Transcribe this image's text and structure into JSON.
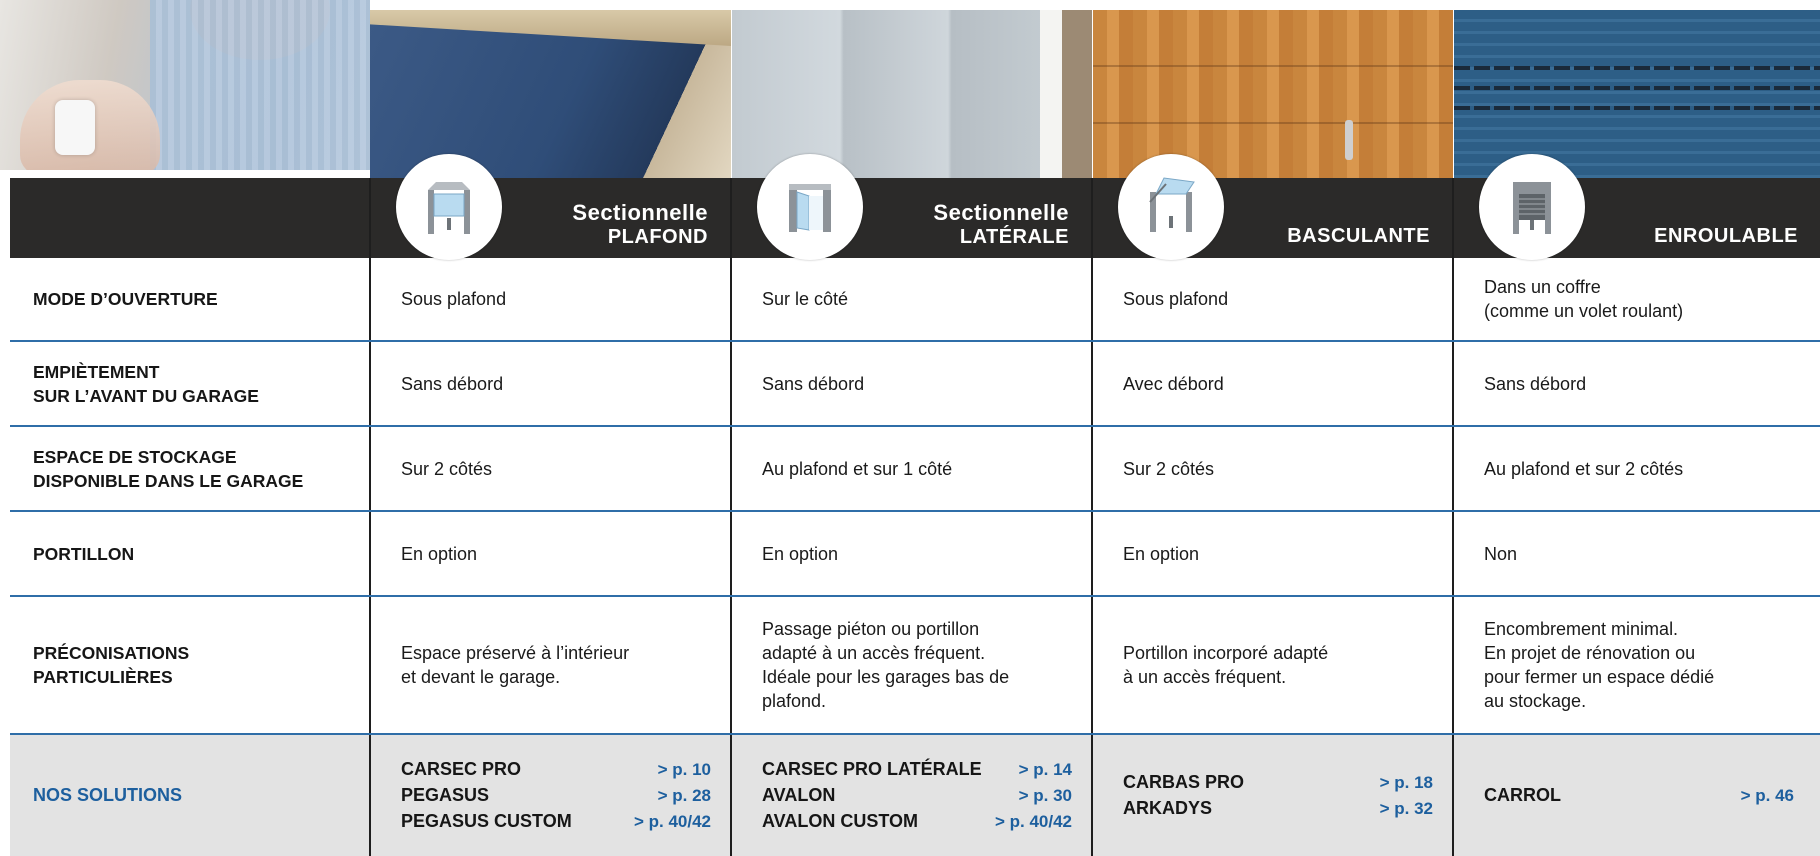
{
  "columns": [
    {
      "title_line1": "Sectionnelle",
      "title_line2": "plafond",
      "icon": "sectional-ceiling-door-icon"
    },
    {
      "title_line1": "Sectionnelle",
      "title_line2": "latérale",
      "icon": "sectional-side-door-icon"
    },
    {
      "title_line1": "",
      "title_line2": "BASCULANTE",
      "icon": "tilting-door-icon"
    },
    {
      "title_line1": "",
      "title_line2": "ENROULABLE",
      "icon": "roller-door-icon"
    }
  ],
  "rows": [
    {
      "label": "MODE D’OUVERTURE",
      "values": [
        "Sous plafond",
        "Sur le côté",
        "Sous plafond",
        "Dans un coffre\n(comme un volet roulant)"
      ]
    },
    {
      "label": "EMPIÈTEMENT\nSUR L’AVANT DU GARAGE",
      "values": [
        "Sans débord",
        "Sans débord",
        "Avec débord",
        "Sans débord"
      ]
    },
    {
      "label": "ESPACE DE STOCKAGE\nDISPONIBLE DANS LE GARAGE",
      "values": [
        "Sur 2 côtés",
        "Au plafond et sur 1 côté",
        "Sur 2 côtés",
        "Au plafond et sur 2 côtés"
      ]
    },
    {
      "label": "PORTILLON",
      "values": [
        "En option",
        "En option",
        "En option",
        "Non"
      ]
    },
    {
      "label": "PRÉCONISATIONS\nPARTICULIÈRES",
      "values": [
        "Espace préservé à l’intérieur\net devant le garage.",
        "Passage piéton ou portillon\nadapté à un accès fréquent.\nIdéale pour les garages bas de\nplafond.",
        "Portillon incorporé adapté\nà un accès fréquent.",
        "Encombrement minimal.\nEn projet de rénovation ou\npour fermer un espace dédié\nau stockage."
      ]
    }
  ],
  "solutions": {
    "label": "NOS SOLUTIONS",
    "columns": [
      [
        {
          "name": "CARSEC PRO",
          "page": "> p. 10"
        },
        {
          "name": "PEGASUS",
          "page": "> p. 28"
        },
        {
          "name": "PEGASUS CUSTOM",
          "page": "> p. 40/42"
        }
      ],
      [
        {
          "name": "CARSEC PRO LATÉRALE",
          "page": "> p. 14"
        },
        {
          "name": "AVALON",
          "page": "> p. 30"
        },
        {
          "name": "AVALON CUSTOM",
          "page": "> p. 40/42"
        }
      ],
      [
        {
          "name": "CARBAS PRO",
          "page": "> p. 18"
        },
        {
          "name": "ARKADYS",
          "page": "> p. 32"
        }
      ],
      [
        {
          "name": "CARROL",
          "page": "> p. 46"
        }
      ]
    ]
  },
  "colors": {
    "header_bg": "#2b2a29",
    "accent_blue": "#1d5f9e",
    "row_separator": "#2f6ea8",
    "solutions_bg": "#e3e3e3"
  }
}
